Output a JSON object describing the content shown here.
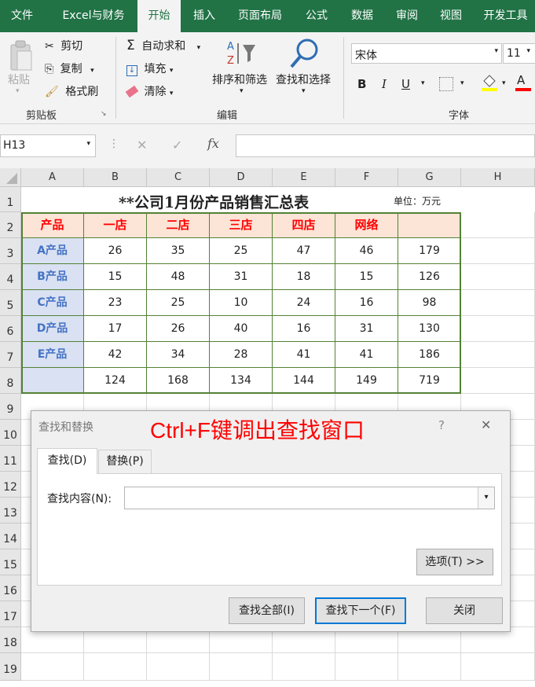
{
  "ribbon_tabs": [
    "文件",
    "Excel与财务",
    "开始",
    "插入",
    "页面布局",
    "公式",
    "数据",
    "审阅",
    "视图",
    "开发工具"
  ],
  "clipboard": {
    "paste": "粘贴",
    "cut": "剪切",
    "copy": "复制",
    "format_painter": "格式刷",
    "group": "剪贴板"
  },
  "editing": {
    "autosum": "自动求和",
    "fill": "填充",
    "clear": "清除",
    "sort_filter": "排序和筛选",
    "find_select": "查找和选择",
    "group": "编辑"
  },
  "font": {
    "name": "宋体",
    "size": "11",
    "bold": "B",
    "italic": "I",
    "underline": "U",
    "font_color_letter": "A",
    "group": "字体"
  },
  "formula_bar": {
    "name_box": "H13",
    "cancel": "✕",
    "enter": "✓",
    "fx": "fx",
    "formula": ""
  },
  "columns": [
    "A",
    "B",
    "C",
    "D",
    "E",
    "F",
    "G",
    "H"
  ],
  "rows": [
    "1",
    "2",
    "3",
    "4",
    "5",
    "6",
    "7",
    "8",
    "9",
    "10",
    "11",
    "12",
    "13",
    "14",
    "15",
    "16",
    "17",
    "18",
    "19"
  ],
  "sheet": {
    "title": "**公司1月份产品销售汇总表",
    "unit": "单位：万元",
    "headers": [
      "产品",
      "一店",
      "二店",
      "三店",
      "四店",
      "网络",
      ""
    ],
    "data": [
      [
        "A产品",
        "26",
        "35",
        "25",
        "47",
        "46",
        "179"
      ],
      [
        "B产品",
        "15",
        "48",
        "31",
        "18",
        "15",
        "126"
      ],
      [
        "C产品",
        "23",
        "25",
        "10",
        "24",
        "16",
        "98"
      ],
      [
        "D产品",
        "17",
        "26",
        "40",
        "16",
        "31",
        "130"
      ],
      [
        "E产品",
        "42",
        "34",
        "28",
        "41",
        "41",
        "186"
      ],
      [
        "",
        "124",
        "168",
        "134",
        "144",
        "149",
        "719"
      ]
    ]
  },
  "dialog": {
    "title": "查找和替换",
    "annotation": "Ctrl+F键调出查找窗口",
    "help": "?",
    "close": "✕",
    "tab_find": "查找(D)",
    "tab_replace": "替换(P)",
    "find_label": "查找内容(N):",
    "find_value": "",
    "options": "选项(T) >>",
    "find_all": "查找全部(I)",
    "find_next": "查找下一个(F)",
    "close_button": "关闭"
  },
  "colors": {
    "ribbon": "#217346",
    "header_fill": "#fce4d6",
    "product_fill": "#d9e1f2",
    "table_border": "#548235",
    "red_text": "#ff0000",
    "blue_text": "#4472c4",
    "annotation": "#ff0000"
  }
}
